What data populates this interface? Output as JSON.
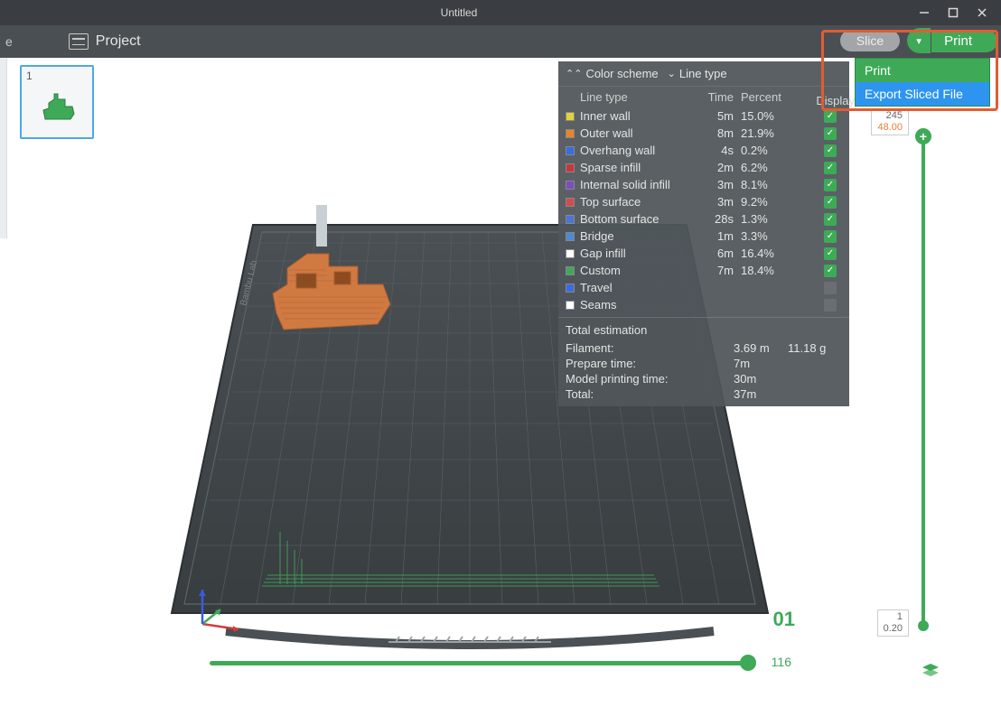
{
  "window": {
    "title": "Untitled"
  },
  "toolbar": {
    "project_label": "Project",
    "slice_label": "Slice",
    "print_label": "Print"
  },
  "dropdown": {
    "print": "Print",
    "export": "Export Sliced File"
  },
  "plate": {
    "index": "1",
    "plate_number": "01"
  },
  "info": {
    "color_scheme_label": "Color scheme",
    "line_type_label": "Line type",
    "headers": {
      "line_type": "Line type",
      "time": "Time",
      "percent": "Percent",
      "display": "Display"
    },
    "rows": [
      {
        "swatch": "#e3d23a",
        "name": "Inner wall",
        "time": "5m",
        "pct": "15.0%",
        "chk": true
      },
      {
        "swatch": "#e8842e",
        "name": "Outer wall",
        "time": "8m",
        "pct": "21.9%",
        "chk": true
      },
      {
        "swatch": "#3a6be0",
        "name": "Overhang wall",
        "time": "4s",
        "pct": "0.2%",
        "chk": true
      },
      {
        "swatch": "#c23b3b",
        "name": "Sparse infill",
        "time": "2m",
        "pct": "6.2%",
        "chk": true
      },
      {
        "swatch": "#7a4dc2",
        "name": "Internal solid infill",
        "time": "3m",
        "pct": "8.1%",
        "chk": true
      },
      {
        "swatch": "#d64a4a",
        "name": "Top surface",
        "time": "3m",
        "pct": "9.2%",
        "chk": true
      },
      {
        "swatch": "#4a74d6",
        "name": "Bottom surface",
        "time": "28s",
        "pct": "1.3%",
        "chk": true
      },
      {
        "swatch": "#4a8ad6",
        "name": "Bridge",
        "time": "1m",
        "pct": "3.3%",
        "chk": true
      },
      {
        "swatch": "#ffffff",
        "name": "Gap infill",
        "time": "6m",
        "pct": "16.4%",
        "chk": true
      },
      {
        "swatch": "#3eaa58",
        "name": "Custom",
        "time": "7m",
        "pct": "18.4%",
        "chk": true
      },
      {
        "swatch": "#3a6be0",
        "name": "Travel",
        "time": "",
        "pct": "",
        "chk": false
      },
      {
        "swatch": "#ffffff",
        "name": "Seams",
        "time": "",
        "pct": "",
        "chk": false
      }
    ],
    "est_title": "Total estimation",
    "est": {
      "filament_k": "Filament:",
      "filament_v1": "3.69 m",
      "filament_v2": "11.18 g",
      "prepare_k": "Prepare time:",
      "prepare_v": "7m",
      "print_k": "Model printing time:",
      "print_v": "30m",
      "total_k": "Total:",
      "total_v": "37m"
    }
  },
  "vslider": {
    "top_a": "245",
    "top_b": "48.00",
    "bot_a": "1",
    "bot_b": "0.20"
  },
  "hslider": {
    "value": "116"
  }
}
